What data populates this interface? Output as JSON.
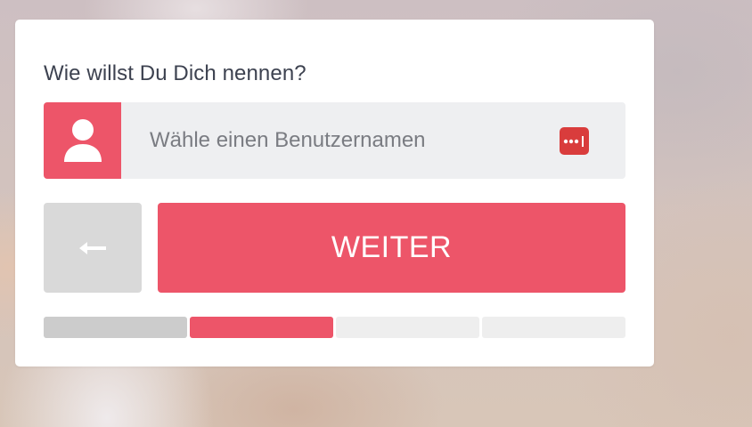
{
  "form": {
    "question": "Wie willst Du Dich nennen?",
    "username_placeholder": "Wähle einen Benutzernamen",
    "username_value": "",
    "user_icon": "user-icon",
    "password_manager_icon": "password-manager-icon",
    "back_label": "←",
    "next_label": "WEITER"
  },
  "progress": {
    "current_step": 2,
    "total_steps": 4,
    "steps": [
      {
        "state": "completed"
      },
      {
        "state": "current"
      },
      {
        "state": "upcoming"
      },
      {
        "state": "upcoming"
      }
    ]
  },
  "colors": {
    "accent": "#ed5569",
    "input_bg": "#eeeff1",
    "back_button_bg": "#d9d9d9",
    "step_completed": "#cccccc",
    "step_current": "#ed5569",
    "step_upcoming": "#eeeeee",
    "password_manager": "#d93c3c"
  }
}
